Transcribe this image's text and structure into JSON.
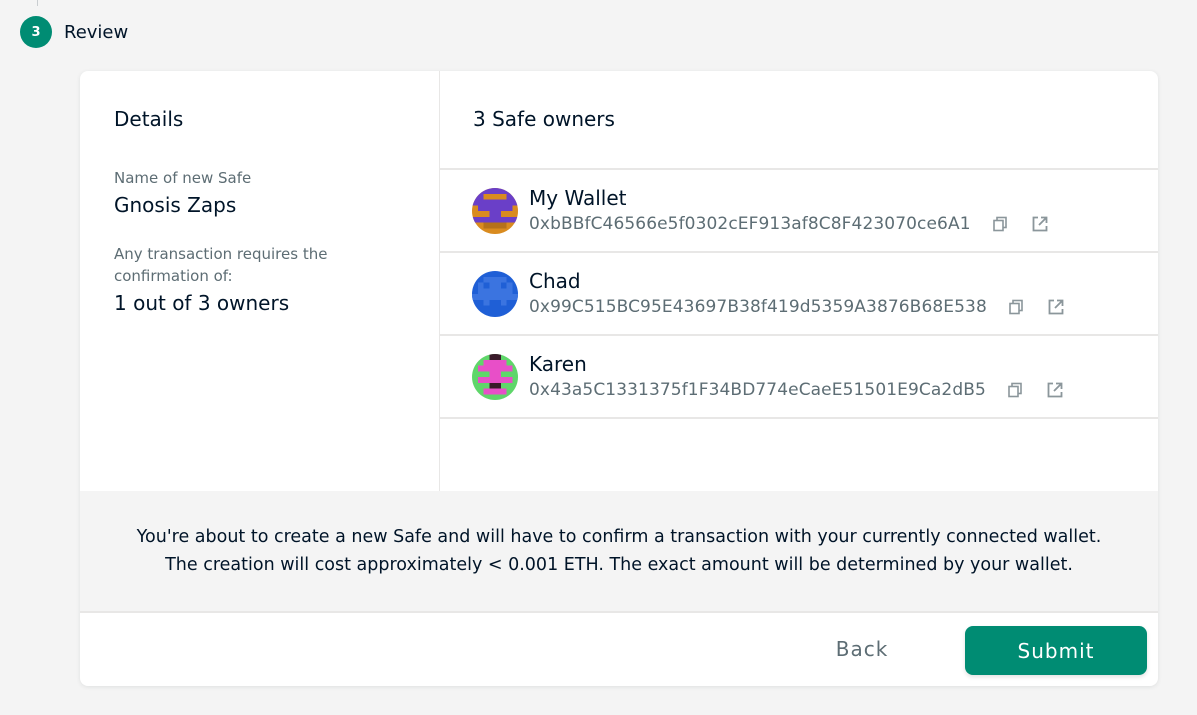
{
  "step": {
    "number": "3",
    "label": "Review"
  },
  "details": {
    "title": "Details",
    "name_label": "Name of new Safe",
    "name_value": "Gnosis Zaps",
    "threshold_label": "Any transaction requires the confirmation of:",
    "threshold_value": "1 out of 3 owners"
  },
  "owners": {
    "title": "3 Safe owners",
    "items": [
      {
        "name": "My Wallet",
        "address": "0xbBBfC46566e5f0302cEF913af8C8F423070ce6A1"
      },
      {
        "name": "Chad",
        "address": "0x99C515BC95E43697B38f419d5359A3876B68E538"
      },
      {
        "name": "Karen",
        "address": "0x43a5C1331375f1F34BD774eCaeE51501E9Ca2dB5"
      }
    ]
  },
  "notice": {
    "line1": "You're about to create a new Safe and will have to confirm a transaction with your currently connected wallet.",
    "line2": "The creation will cost approximately < 0.001 ETH. The exact amount will be determined by your wallet."
  },
  "footer": {
    "back_label": "Back",
    "submit_label": "Submit"
  },
  "icons": {
    "copy": "copy-icon",
    "external": "external-link-icon"
  },
  "colors": {
    "accent": "#008c73",
    "text": "#001428",
    "muted": "#5d6d74"
  }
}
